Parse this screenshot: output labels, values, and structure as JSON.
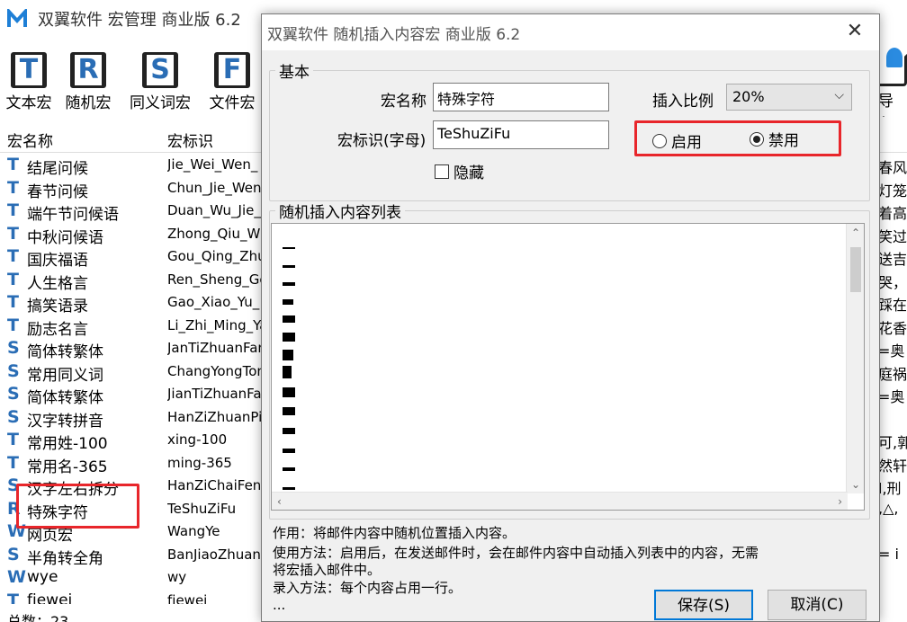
{
  "main": {
    "title": "双翼软件 宏管理 商业版 6.2",
    "toolbar": [
      {
        "icon": "T",
        "label": "文本宏"
      },
      {
        "icon": "R",
        "label": "随机宏"
      },
      {
        "icon": "S",
        "label": "同义词宏"
      },
      {
        "icon": "F",
        "label": "文件宏"
      },
      {
        "label": "导入"
      }
    ],
    "columns": {
      "name": "宏名称",
      "id": "宏标识"
    },
    "rows": [
      {
        "type": "T",
        "name": "结尾问候",
        "id": "Jie_Wei_Wen_",
        "extra": "春风"
      },
      {
        "type": "T",
        "name": "春节问候",
        "id": "Chun_Jie_Wen",
        "extra": "灯笼"
      },
      {
        "type": "T",
        "name": "端午节问候语",
        "id": "Duan_Wu_Jie_",
        "extra": "着高"
      },
      {
        "type": "T",
        "name": "中秋问候语",
        "id": "Zhong_Qiu_W",
        "extra": "笑过"
      },
      {
        "type": "T",
        "name": "国庆福语",
        "id": "Gou_Qing_Zhu",
        "extra": "送吉"
      },
      {
        "type": "T",
        "name": "人生格言",
        "id": "Ren_Sheng_Ge",
        "extra": "哭，"
      },
      {
        "type": "T",
        "name": "搞笑语录",
        "id": "Gao_Xiao_Yu_",
        "extra": "踩在"
      },
      {
        "type": "T",
        "name": "励志名言",
        "id": "Li_Zhi_Ming_Ya",
        "extra": "花香"
      },
      {
        "type": "S",
        "name": "简体转繁体",
        "id": "JanTiZhuanFan",
        "extra": "=奥"
      },
      {
        "type": "S",
        "name": "常用同义词",
        "id": "ChangYongTon",
        "extra": "庭祸"
      },
      {
        "type": "S",
        "name": "简体转繁体",
        "id": "JianTiZhuanFa",
        "extra": "=奥"
      },
      {
        "type": "S",
        "name": "汉字转拼音",
        "id": "HanZiZhuanPin",
        "extra": ""
      },
      {
        "type": "T",
        "name": "常用姓-100",
        "id": "xing-100",
        "extra": "可,郭"
      },
      {
        "type": "T",
        "name": "常用名-365",
        "id": "ming-365",
        "extra": "然轩,"
      },
      {
        "type": "S",
        "name": "汉字左右拆分",
        "id": "HanZiChaiFen",
        "extra": "l,刑"
      },
      {
        "type": "R",
        "name": "特殊字符",
        "id": "TeShuZiFu",
        "extra": ",△,"
      },
      {
        "type": "W",
        "name": "网页宏",
        "id": "WangYe",
        "extra": ""
      },
      {
        "type": "S",
        "name": "半角转全角",
        "id": "BanJiaoZhuan",
        "extra": "= i"
      },
      {
        "type": "W",
        "name": "wye",
        "id": "wy",
        "extra": ""
      },
      {
        "type": "T",
        "name": "fjewei",
        "id": "fjewei",
        "extra": ""
      }
    ],
    "status": "总数：23"
  },
  "dialog": {
    "title": "双翼软件 随机插入内容宏 商业版 6.2",
    "close": "✕",
    "basic_legend": "基本",
    "name_label": "宏名称",
    "name_value": "特殊字符",
    "id_label": "宏标识(字母)",
    "id_value": "TeShuZiFu",
    "hidden_label": "隐藏",
    "ratio_label": "插入比例",
    "ratio_value": "20%",
    "enable_label": "启用",
    "disable_label": "禁用",
    "list_legend": "随机插入内容列表",
    "list_marks": [
      {
        "w": 14,
        "h": 2
      },
      {
        "w": 14,
        "h": 3
      },
      {
        "w": 14,
        "h": 4
      },
      {
        "w": 12,
        "h": 6
      },
      {
        "w": 14,
        "h": 8
      },
      {
        "w": 14,
        "h": 10
      },
      {
        "w": 12,
        "h": 12
      },
      {
        "w": 10,
        "h": 14
      },
      {
        "w": 14,
        "h": 11
      },
      {
        "w": 14,
        "h": 9
      },
      {
        "w": 14,
        "h": 7
      },
      {
        "w": 14,
        "h": 5
      },
      {
        "w": 14,
        "h": 4
      },
      {
        "w": 14,
        "h": 3
      }
    ],
    "desc1": "作用：将邮件内容中随机位置插入内容。",
    "desc2": "使用方法：启用后，在发送邮件时，会在邮件内容中自动插入列表中的内容，无需",
    "desc3": "将宏插入邮件中。",
    "desc4": "录入方法：每个内容占用一行。",
    "desc5": "...",
    "save": "保存(S)",
    "cancel": "取消(C)"
  }
}
